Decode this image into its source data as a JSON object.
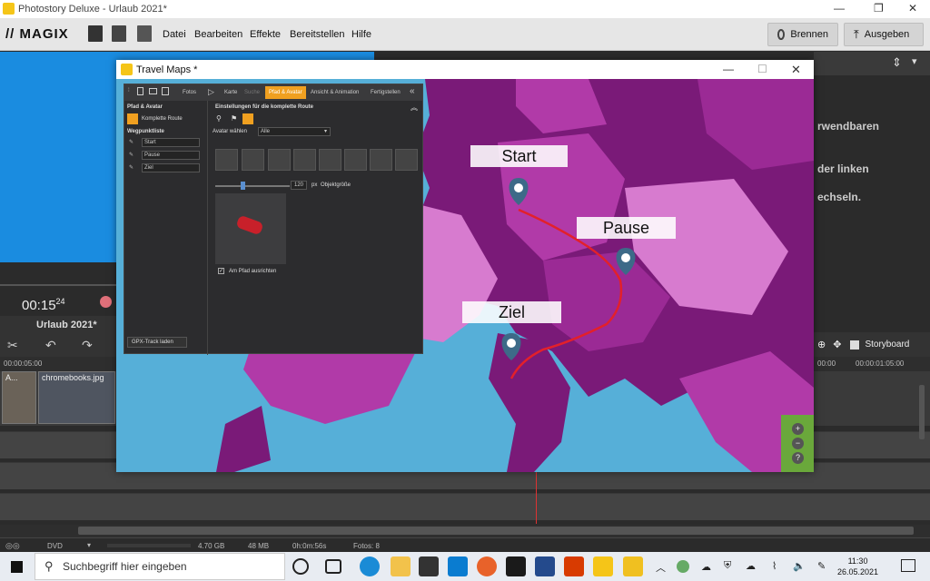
{
  "window": {
    "title": "Photostory Deluxe - Urlaub 2021*",
    "controls": {
      "minimize": "—",
      "maximize": "❐",
      "close": "✕"
    }
  },
  "menubar": {
    "brand": "// MAGIX",
    "items": [
      "Datei",
      "Bearbeiten",
      "Effekte",
      "Bereitstellen",
      "Hilfe"
    ],
    "burn_button": "Brennen",
    "export_button": "Ausgeben"
  },
  "preview": {
    "timecode": "00:15",
    "timecode_frames": "24"
  },
  "project": {
    "title": "Urlaub 2021*"
  },
  "timeline": {
    "ruler_left": "00:00:05:00",
    "ruler_right_a": "00:00",
    "ruler_right_b": "00:00:01:05:00",
    "clips": [
      {
        "label": "A..."
      },
      {
        "label": "chromebooks.jpg"
      }
    ]
  },
  "right_panel": {
    "hint_lines": [
      "rwendbaren",
      "der linken",
      "echseln."
    ],
    "storyboard_label": "Storyboard"
  },
  "statusbar": {
    "disc": "DVD",
    "capacity": "4.70 GB",
    "used": "48 MB",
    "duration": "0h:0m:56s",
    "photos": "Fotos: 8"
  },
  "dialog": {
    "title": "Travel Maps *",
    "controls": {
      "minimize": "—",
      "maximize": "☐",
      "close": "✕"
    },
    "toolbar_tabs": [
      "Fotos",
      "Karte",
      "Suche",
      "Pfad & Avatar",
      "Ansicht & Animation",
      "Fertigstellen"
    ],
    "active_tab": "Pfad & Avatar",
    "left": {
      "section": "Pfad & Avatar",
      "route_item": "Komplette Route",
      "waypoint_header": "Wegpunktliste",
      "waypoints": [
        "Start",
        "Pause",
        "Ziel"
      ],
      "gpx_button": "GPX-Track laden"
    },
    "right": {
      "settings_title": "Einstellungen für die komplette Route",
      "avatar_label": "Avatar wählen",
      "avatar_filter": "Alle",
      "size_value": "120",
      "size_unit": "px",
      "size_label": "Objektgröße",
      "align_label": "Am Pfad ausrichten"
    },
    "map_labels": {
      "start": "Start",
      "pause": "Pause",
      "ziel": "Ziel"
    },
    "zoom": {
      "in": "+",
      "out": "−",
      "help": "?"
    }
  },
  "taskbar": {
    "search_placeholder": "Suchbegriff hier eingeben",
    "time": "11:30",
    "date": "26.05.2021"
  },
  "colors": {
    "accent": "#f0a020",
    "route": "#e3202a",
    "pin": "#3d6a88",
    "preview_blue": "#1a8ce0"
  }
}
